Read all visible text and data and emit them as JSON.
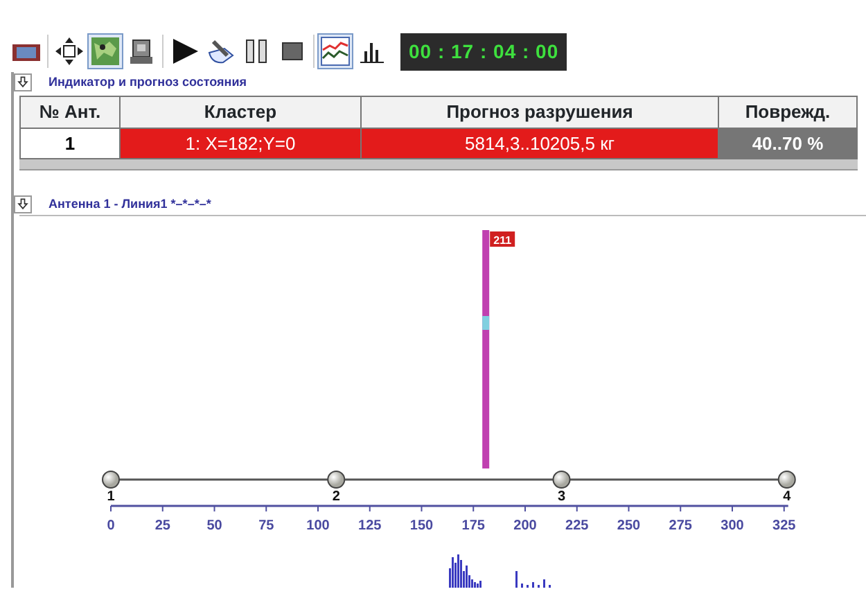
{
  "toolbar": {
    "buttons": [
      {
        "kind": "strip",
        "selected": false
      },
      {
        "kind": "move",
        "selected": false
      },
      {
        "kind": "map",
        "selected": true
      },
      {
        "kind": "device",
        "selected": false
      },
      {
        "kind": "play",
        "selected": false
      },
      {
        "kind": "tool",
        "selected": false
      },
      {
        "kind": "pause",
        "selected": false
      },
      {
        "kind": "stop",
        "selected": false
      },
      {
        "kind": "graph",
        "selected": true
      },
      {
        "kind": "bars",
        "selected": false
      }
    ],
    "timer": "00 : 17 : 04 : 00"
  },
  "state_panel": {
    "title": "Индикатор и прогноз состояния",
    "table": {
      "columns": [
        "№ Ант.",
        "Кластер",
        "Прогноз разрушения",
        "Поврежд."
      ],
      "rows": [
        [
          {
            "text": "1",
            "color": "#ffffff"
          },
          {
            "text": "1: X=182;Y=0",
            "color": "#e31b1b"
          },
          {
            "text": "5814,3..10205,5 кг",
            "color": "#e31b1b"
          },
          {
            "text": "40..70 %",
            "color": "#767676"
          }
        ]
      ]
    }
  },
  "plot_panel": {
    "title": "Антенна 1 - Линия1 *–*–*–*",
    "axis_ticks": [
      "0",
      "25",
      "50",
      "75",
      "100",
      "125",
      "150",
      "175",
      "200",
      "225",
      "250",
      "275",
      "300",
      "325"
    ],
    "sensors": [
      {
        "label": "1"
      },
      {
        "label": "2"
      },
      {
        "label": "3"
      },
      {
        "label": "4"
      }
    ],
    "event": {
      "count": "211"
    }
  }
}
